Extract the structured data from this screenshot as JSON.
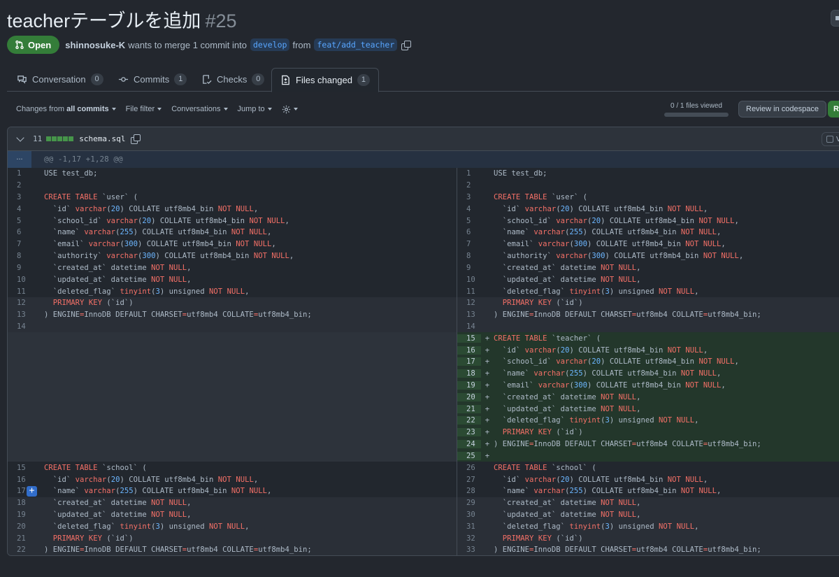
{
  "pr": {
    "title": "teacherテーブルを追加",
    "number": "#25",
    "status": "Open",
    "author": "shinnosuke-K",
    "merge_text": "wants to merge 1 commit into",
    "base_branch": "develop",
    "from_text": "from",
    "head_branch": "feat/add_teacher"
  },
  "tabs": [
    {
      "label": "Conversation",
      "count": "0",
      "icon": "comment-icon"
    },
    {
      "label": "Commits",
      "count": "1",
      "icon": "commit-icon"
    },
    {
      "label": "Checks",
      "count": "0",
      "icon": "checklist-icon"
    },
    {
      "label": "Files changed",
      "count": "1",
      "icon": "file-diff-icon",
      "active": true
    }
  ],
  "toolbar": {
    "changes_prefix": "Changes from",
    "changes_value": "all commits",
    "file_filter": "File filter",
    "conversations": "Conversations",
    "jump_to": "Jump to",
    "files_viewed": "0 / 1 files viewed",
    "review_codespace": "Review in codespace",
    "green_button_initial": "R"
  },
  "file": {
    "change_count": "11",
    "name": "schema.sql",
    "viewed_label": "Vi",
    "hunk_header": "@@ -1,17 +1,28 @@",
    "expander": "..."
  },
  "diff": {
    "left": [
      {
        "n": "1",
        "t": "USE test_db;"
      },
      {
        "n": "2",
        "t": ""
      },
      {
        "n": "3",
        "t": "CREATE TABLE `user` ("
      },
      {
        "n": "4",
        "t": "  `id` varchar(20) COLLATE utf8mb4_bin NOT NULL,"
      },
      {
        "n": "5",
        "t": "  `school_id` varchar(20) COLLATE utf8mb4_bin NOT NULL,"
      },
      {
        "n": "6",
        "t": "  `name` varchar(255) COLLATE utf8mb4_bin NOT NULL,"
      },
      {
        "n": "7",
        "t": "  `email` varchar(300) COLLATE utf8mb4_bin NOT NULL,"
      },
      {
        "n": "8",
        "t": "  `authority` varchar(300) COLLATE utf8mb4_bin NOT NULL,"
      },
      {
        "n": "9",
        "t": "  `created_at` datetime NOT NULL,"
      },
      {
        "n": "10",
        "t": "  `updated_at` datetime NOT NULL,"
      },
      {
        "n": "11",
        "t": "  `deleted_flag` tinyint(3) unsigned NOT NULL,"
      },
      {
        "n": "12",
        "t": "  PRIMARY KEY (`id`)",
        "sep": true
      },
      {
        "n": "13",
        "t": ") ENGINE=InnoDB DEFAULT CHARSET=utf8mb4 COLLATE=utf8mb4_bin;",
        "sep": true
      },
      {
        "n": "14",
        "t": "",
        "sep": true
      },
      {
        "n": "",
        "t": "",
        "empty": true
      },
      {
        "n": "",
        "t": "",
        "empty": true
      },
      {
        "n": "",
        "t": "",
        "empty": true
      },
      {
        "n": "",
        "t": "",
        "empty": true
      },
      {
        "n": "",
        "t": "",
        "empty": true
      },
      {
        "n": "",
        "t": "",
        "empty": true
      },
      {
        "n": "",
        "t": "",
        "empty": true
      },
      {
        "n": "",
        "t": "",
        "empty": true
      },
      {
        "n": "",
        "t": "",
        "empty": true
      },
      {
        "n": "",
        "t": "",
        "empty": true
      },
      {
        "n": "",
        "t": "",
        "empty": true
      },
      {
        "n": "15",
        "t": "CREATE TABLE `school` ("
      },
      {
        "n": "16",
        "t": "  `id` varchar(20) COLLATE utf8mb4_bin NOT NULL,"
      },
      {
        "n": "17",
        "t": "  `name` varchar(255) COLLATE utf8mb4_bin NOT NULL,",
        "plus": true
      },
      {
        "n": "18",
        "t": "  `created_at` datetime NOT NULL,",
        "sep": true
      },
      {
        "n": "19",
        "t": "  `updated_at` datetime NOT NULL,",
        "sep": true
      },
      {
        "n": "20",
        "t": "  `deleted_flag` tinyint(3) unsigned NOT NULL,",
        "sep": true
      },
      {
        "n": "21",
        "t": "  PRIMARY KEY (`id`)",
        "sep": true
      },
      {
        "n": "22",
        "t": ") ENGINE=InnoDB DEFAULT CHARSET=utf8mb4 COLLATE=utf8mb4_bin;",
        "sep": true
      }
    ],
    "right": [
      {
        "n": "1",
        "t": "USE test_db;"
      },
      {
        "n": "2",
        "t": ""
      },
      {
        "n": "3",
        "t": "CREATE TABLE `user` ("
      },
      {
        "n": "4",
        "t": "  `id` varchar(20) COLLATE utf8mb4_bin NOT NULL,"
      },
      {
        "n": "5",
        "t": "  `school_id` varchar(20) COLLATE utf8mb4_bin NOT NULL,"
      },
      {
        "n": "6",
        "t": "  `name` varchar(255) COLLATE utf8mb4_bin NOT NULL,"
      },
      {
        "n": "7",
        "t": "  `email` varchar(300) COLLATE utf8mb4_bin NOT NULL,"
      },
      {
        "n": "8",
        "t": "  `authority` varchar(300) COLLATE utf8mb4_bin NOT NULL,"
      },
      {
        "n": "9",
        "t": "  `created_at` datetime NOT NULL,"
      },
      {
        "n": "10",
        "t": "  `updated_at` datetime NOT NULL,"
      },
      {
        "n": "11",
        "t": "  `deleted_flag` tinyint(3) unsigned NOT NULL,"
      },
      {
        "n": "12",
        "t": "  PRIMARY KEY (`id`)",
        "sep": true
      },
      {
        "n": "13",
        "t": ") ENGINE=InnoDB DEFAULT CHARSET=utf8mb4 COLLATE=utf8mb4_bin;",
        "sep": true
      },
      {
        "n": "14",
        "t": "",
        "sep": true
      },
      {
        "n": "15",
        "t": "CREATE TABLE `teacher` (",
        "add": true
      },
      {
        "n": "16",
        "t": "  `id` varchar(20) COLLATE utf8mb4_bin NOT NULL,",
        "add": true
      },
      {
        "n": "17",
        "t": "  `school_id` varchar(20) COLLATE utf8mb4_bin NOT NULL,",
        "add": true
      },
      {
        "n": "18",
        "t": "  `name` varchar(255) COLLATE utf8mb4_bin NOT NULL,",
        "add": true
      },
      {
        "n": "19",
        "t": "  `email` varchar(300) COLLATE utf8mb4_bin NOT NULL,",
        "add": true
      },
      {
        "n": "20",
        "t": "  `created_at` datetime NOT NULL,",
        "add": true
      },
      {
        "n": "21",
        "t": "  `updated_at` datetime NOT NULL,",
        "add": true
      },
      {
        "n": "22",
        "t": "  `deleted_flag` tinyint(3) unsigned NOT NULL,",
        "add": true
      },
      {
        "n": "23",
        "t": "  PRIMARY KEY (`id`)",
        "add": true
      },
      {
        "n": "24",
        "t": ") ENGINE=InnoDB DEFAULT CHARSET=utf8mb4 COLLATE=utf8mb4_bin;",
        "add": true
      },
      {
        "n": "25",
        "t": "",
        "add": true
      },
      {
        "n": "26",
        "t": "CREATE TABLE `school` ("
      },
      {
        "n": "27",
        "t": "  `id` varchar(20) COLLATE utf8mb4_bin NOT NULL,"
      },
      {
        "n": "28",
        "t": "  `name` varchar(255) COLLATE utf8mb4_bin NOT NULL,"
      },
      {
        "n": "29",
        "t": "  `created_at` datetime NOT NULL,",
        "sep": true
      },
      {
        "n": "30",
        "t": "  `updated_at` datetime NOT NULL,",
        "sep": true
      },
      {
        "n": "31",
        "t": "  `deleted_flag` tinyint(3) unsigned NOT NULL,",
        "sep": true
      },
      {
        "n": "32",
        "t": "  PRIMARY KEY (`id`)",
        "sep": true
      },
      {
        "n": "33",
        "t": ") ENGINE=InnoDB DEFAULT CHARSET=utf8mb4 COLLATE=utf8mb4_bin;",
        "sep": true
      }
    ]
  },
  "colors": {
    "open_badge": "#347d39",
    "added_bg": "#23372b",
    "keyword": "#f47067",
    "number": "#6cb6ff",
    "link": "#58a6ff"
  }
}
